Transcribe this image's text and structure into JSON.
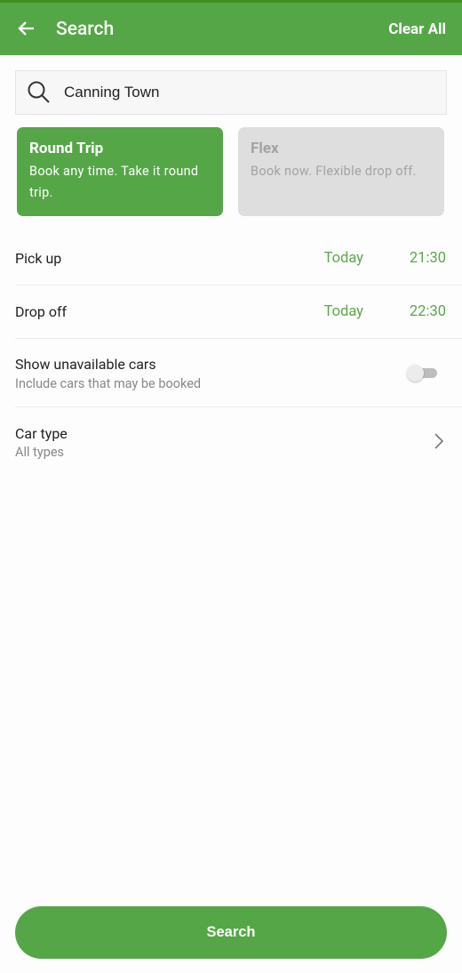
{
  "header": {
    "title": "Search",
    "clear_label": "Clear All",
    "accent": "#55a647"
  },
  "search": {
    "value": "Canning Town",
    "icon": "search-icon"
  },
  "trip_types": [
    {
      "title": "Round Trip",
      "description": "Book any time. Take it round trip.",
      "selected": true
    },
    {
      "title": "Flex",
      "description": "Book now. Flexible drop off.",
      "selected": false
    }
  ],
  "pickup": {
    "label": "Pick up",
    "day": "Today",
    "time": "21:30"
  },
  "dropoff": {
    "label": "Drop off",
    "day": "Today",
    "time": "22:30"
  },
  "unavailable": {
    "label": "Show unavailable cars",
    "sublabel": "Include cars that may be booked",
    "enabled": false
  },
  "car_type": {
    "label": "Car type",
    "value": "All types"
  },
  "search_button": "Search"
}
